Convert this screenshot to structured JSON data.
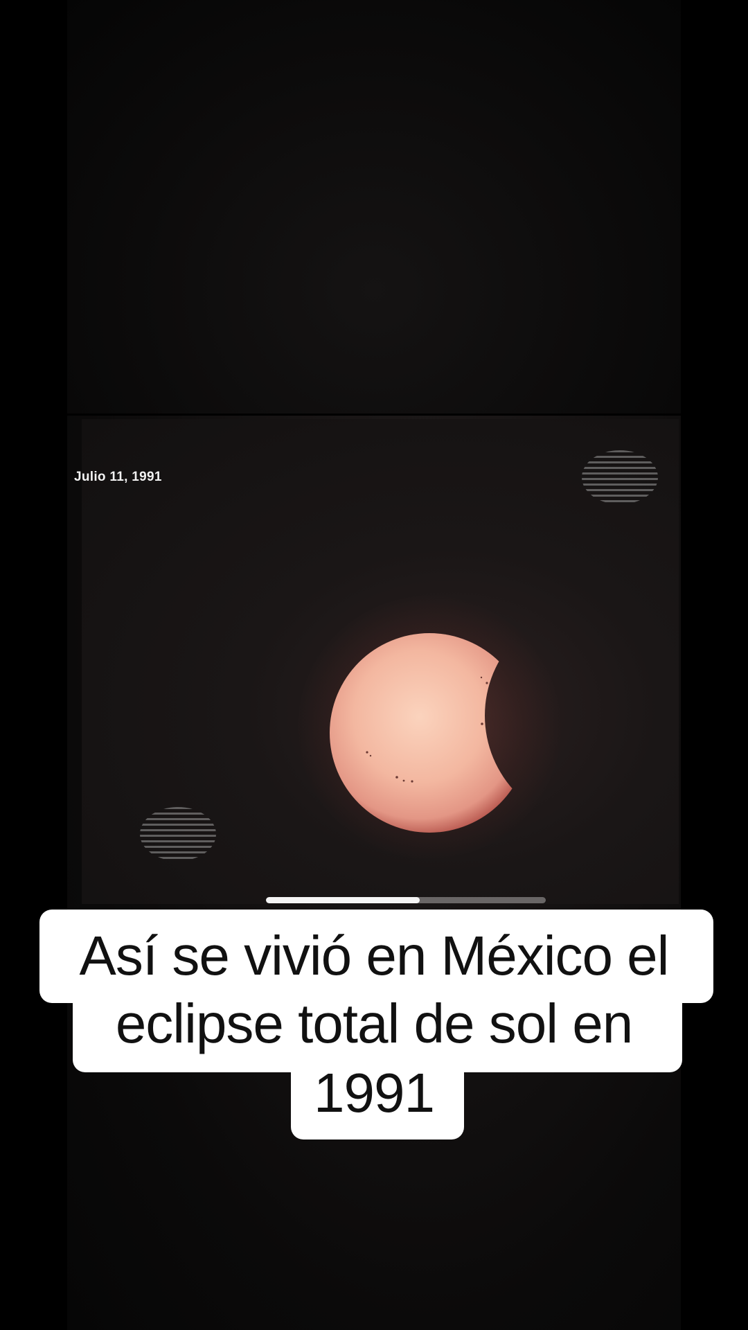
{
  "video": {
    "date_overlay": "Julio 11, 1991",
    "progress": 0.55
  },
  "caption": {
    "line1": "Así se vivió en México el",
    "line2": "eclipse total de sol en",
    "line3": "1991"
  },
  "colors": {
    "background": "#000000",
    "sun": "#f3b9a2",
    "caption_bg": "#ffffff",
    "caption_text": "#111111"
  }
}
